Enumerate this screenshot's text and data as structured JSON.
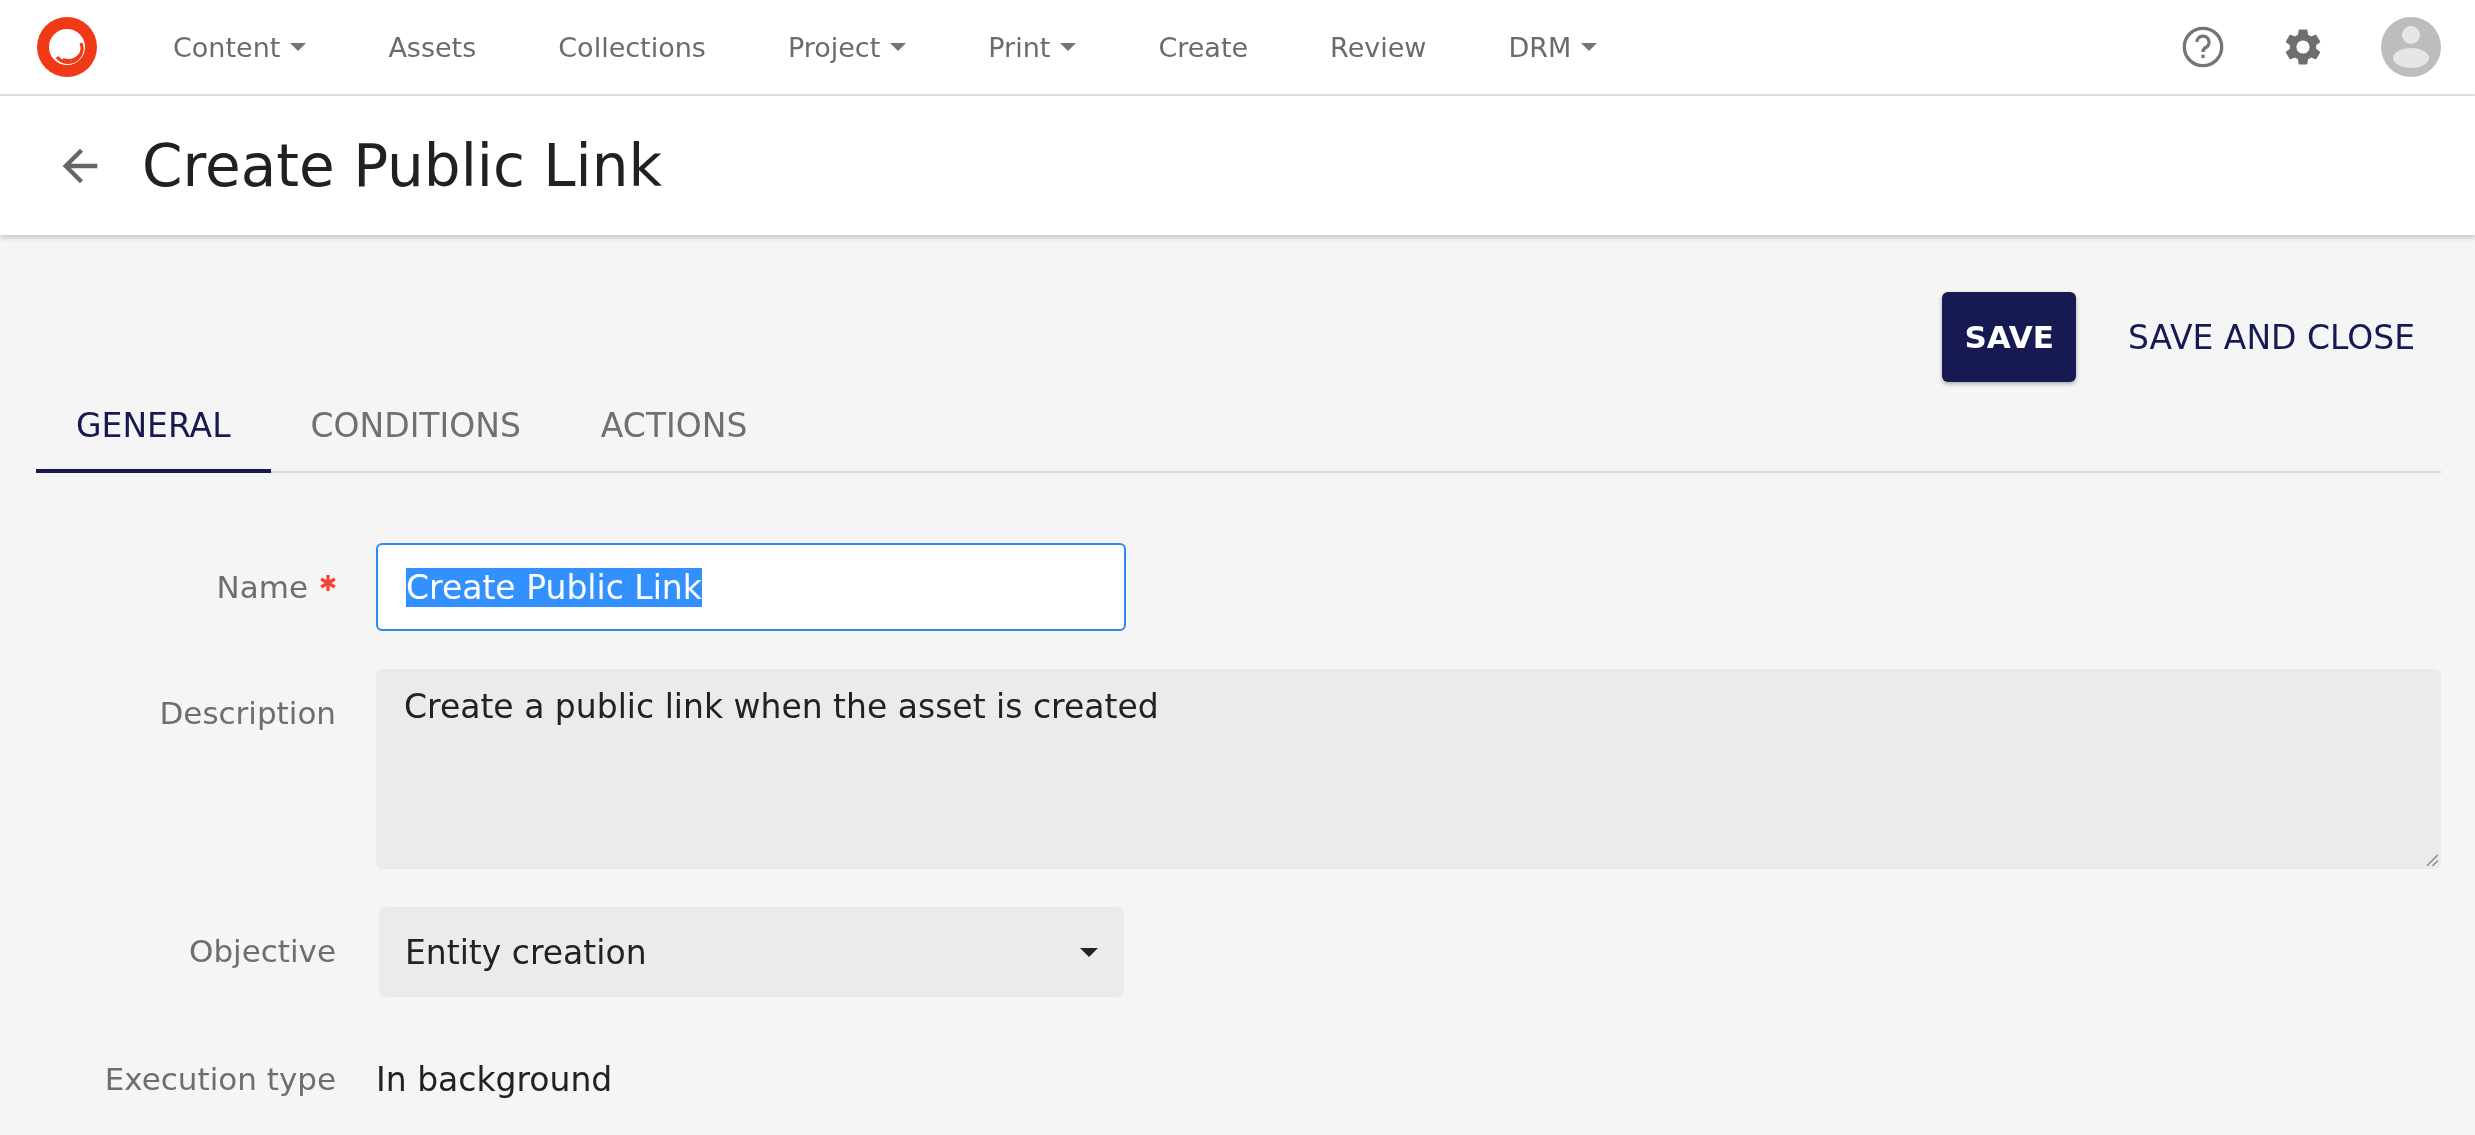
{
  "nav": {
    "items": [
      {
        "label": "Content",
        "dropdown": true
      },
      {
        "label": "Assets",
        "dropdown": false
      },
      {
        "label": "Collections",
        "dropdown": false
      },
      {
        "label": "Project",
        "dropdown": true
      },
      {
        "label": "Print",
        "dropdown": true
      },
      {
        "label": "Create",
        "dropdown": false
      },
      {
        "label": "Review",
        "dropdown": false
      },
      {
        "label": "DRM",
        "dropdown": true
      }
    ]
  },
  "header": {
    "title": "Create Public Link"
  },
  "actions": [
    {
      "label": "SAVE",
      "kind": "primary"
    },
    {
      "label": "SAVE AND CLOSE",
      "kind": "text"
    }
  ],
  "tabs": [
    {
      "label": "GENERAL",
      "selected": true
    },
    {
      "label": "CONDITIONS",
      "selected": false
    },
    {
      "label": "ACTIONS",
      "selected": false
    }
  ],
  "form": {
    "fields": [
      {
        "label": "Name",
        "required": true,
        "kind": "input",
        "value": "Create Public Link",
        "focused": true,
        "text_selected": true
      },
      {
        "label": "Description",
        "required": false,
        "kind": "textarea",
        "value": "Create a public link when the asset is created"
      },
      {
        "label": "Objective",
        "required": false,
        "kind": "select",
        "value": "Entity creation"
      },
      {
        "label": "Execution type",
        "required": false,
        "kind": "static",
        "value": "In background"
      }
    ]
  }
}
